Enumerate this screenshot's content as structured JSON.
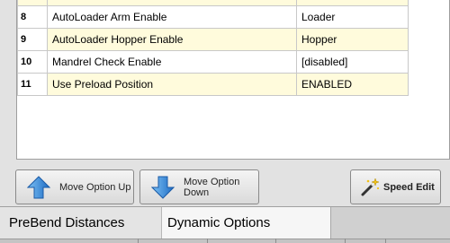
{
  "options": {
    "rows": [
      {
        "num": "8",
        "name": "AutoLoader Arm Enable",
        "value": "Loader"
      },
      {
        "num": "9",
        "name": "AutoLoader Hopper Enable",
        "value": "Hopper"
      },
      {
        "num": "10",
        "name": "Mandrel Check Enable",
        "value": "[disabled]"
      },
      {
        "num": "11",
        "name": "Use Preload Position",
        "value": "ENABLED"
      }
    ]
  },
  "toolbar": {
    "move_up_label": "Move Option Up",
    "move_down_label": "Move Option Down",
    "speed_edit_label": "Speed Edit",
    "move_up_icon": "arrow-up-icon",
    "move_down_icon": "arrow-down-icon",
    "speed_edit_icon": "magic-wand-icon"
  },
  "tabs": [
    {
      "label": "PreBend Distances",
      "active": false
    },
    {
      "label": "Dynamic Options",
      "active": true
    }
  ],
  "colors": {
    "row_alt": "#fffbdc",
    "arrow_blue": "#2a7fd4"
  }
}
